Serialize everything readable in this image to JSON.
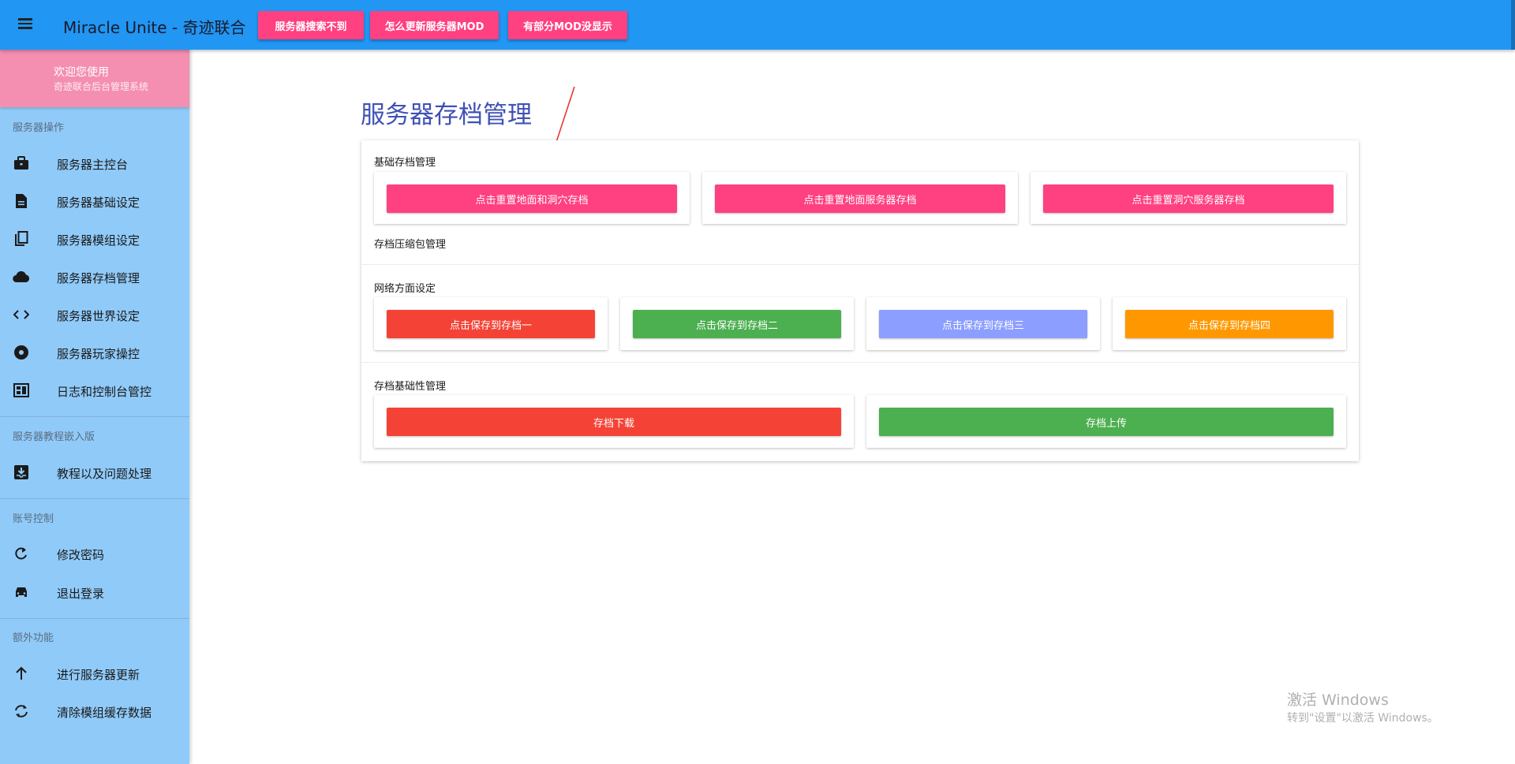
{
  "appbar": {
    "title": "Miracle Unite - 奇迹联合",
    "buttons": [
      "服务器搜索不到",
      "怎么更新服务器MOD",
      "有部分MOD没显示"
    ]
  },
  "sidebar": {
    "welcome_title": "欢迎您使用",
    "welcome_subtitle": "奇迹联合后台管理系统",
    "sections": [
      {
        "label": "服务器操作",
        "items": [
          {
            "icon": "briefcase-icon",
            "label": "服务器主控台"
          },
          {
            "icon": "document-icon",
            "label": "服务器基础设定"
          },
          {
            "icon": "copy-icon",
            "label": "服务器模组设定"
          },
          {
            "icon": "cloud-icon",
            "label": "服务器存档管理"
          },
          {
            "icon": "code-icon",
            "label": "服务器世界设定"
          },
          {
            "icon": "disc-icon",
            "label": "服务器玩家操控"
          },
          {
            "icon": "dashboard-icon",
            "label": "日志和控制台管控"
          }
        ]
      },
      {
        "label": "服务器教程嵌入版",
        "items": [
          {
            "icon": "inbox-download-icon",
            "label": "教程以及问题处理"
          }
        ]
      },
      {
        "label": "账号控制",
        "items": [
          {
            "icon": "rotate-icon",
            "label": "修改密码"
          },
          {
            "icon": "car-icon",
            "label": "退出登录"
          }
        ]
      },
      {
        "label": "额外功能",
        "items": [
          {
            "icon": "arrow-up-icon",
            "label": "进行服务器更新"
          },
          {
            "icon": "sync-icon",
            "label": "清除模组缓存数据"
          }
        ]
      }
    ]
  },
  "main": {
    "page_title": "服务器存档管理",
    "sections": {
      "basic": {
        "label": "基础存档管理",
        "buttons": [
          {
            "label": "点击重置地面和洞穴存档",
            "color": "#FF4081"
          },
          {
            "label": "点击重置地面服务器存档",
            "color": "#FF4081"
          },
          {
            "label": "点击重置洞穴服务器存档",
            "color": "#FF4081"
          }
        ]
      },
      "compress": {
        "label": "存档压缩包管理"
      },
      "network": {
        "label": "网络方面设定",
        "buttons": [
          {
            "label": "点击保存到存档一",
            "color": "#F44336"
          },
          {
            "label": "点击保存到存档二",
            "color": "#4CAF50"
          },
          {
            "label": "点击保存到存档三",
            "color": "#8C9EFF"
          },
          {
            "label": "点击保存到存档四",
            "color": "#FF9800"
          }
        ]
      },
      "archive": {
        "label": "存档基础性管理",
        "buttons": [
          {
            "label": "存档下载",
            "color": "#F44336"
          },
          {
            "label": "存档上传",
            "color": "#4CAF50"
          }
        ]
      }
    }
  },
  "watermark": {
    "title": "激活 Windows",
    "subtitle": "转到\"设置\"以激活 Windows。"
  },
  "colors": {
    "appbar": "#2196F3",
    "sidebar": "#90CAF9",
    "welcome": "#F48FB1",
    "accent_pink": "#FF4081",
    "title_indigo": "#3F51B5",
    "annotation_arrow": "#E53935"
  }
}
